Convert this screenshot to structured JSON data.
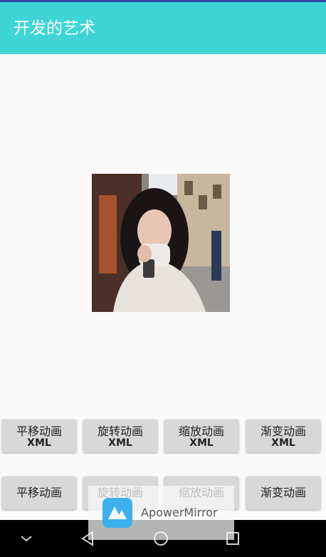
{
  "app": {
    "title": "开发的艺术"
  },
  "image": {
    "description_name": "portrait-photo"
  },
  "buttons_xml": [
    {
      "label": "平移动画",
      "sub": "XML"
    },
    {
      "label": "旋转动画",
      "sub": "XML"
    },
    {
      "label": "缩放动画",
      "sub": "XML"
    },
    {
      "label": "渐变动画",
      "sub": "XML"
    }
  ],
  "buttons_code": [
    {
      "label": "平移动画"
    },
    {
      "label": "旋转动画"
    },
    {
      "label": "缩放动画"
    },
    {
      "label": "渐变动画"
    }
  ],
  "overlay": {
    "text": "ApowerMirror"
  },
  "colors": {
    "toolbar": "#3fd5d5",
    "status_strip": "#3949ab",
    "background": "#fafafa",
    "button": "#d8d8d8",
    "navbar": "#000000"
  },
  "navbar": {
    "icons": [
      "chevron-down-icon",
      "back-icon",
      "home-icon",
      "recents-icon"
    ]
  }
}
